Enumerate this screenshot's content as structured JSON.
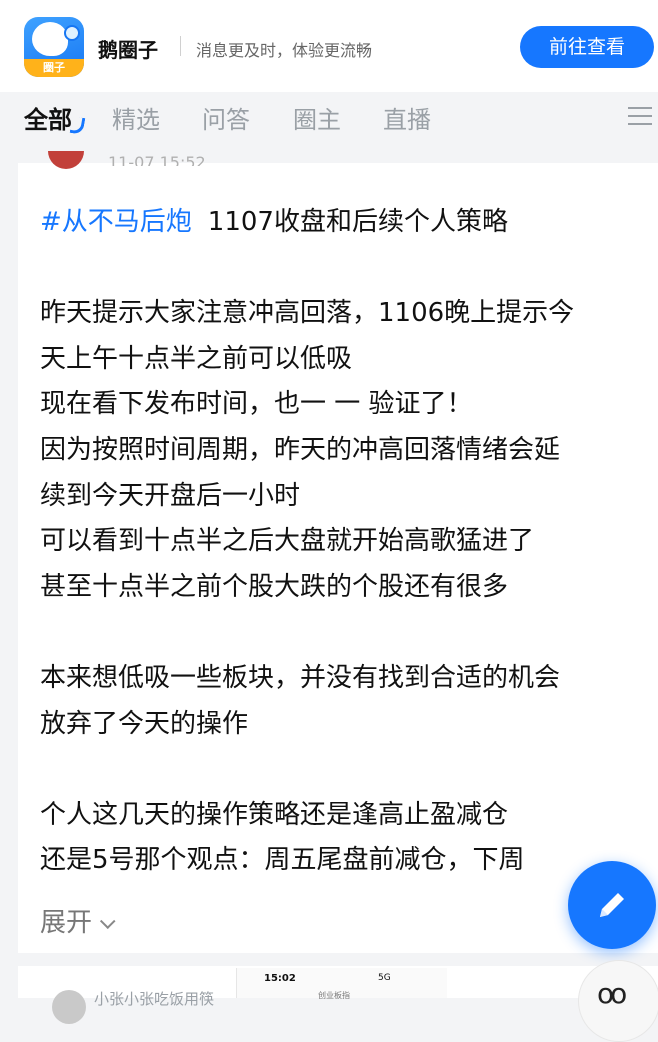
{
  "banner": {
    "logo_tag": "圈子",
    "app_name": "鹅圈子",
    "slogan": "消息更及时，体验更流畅",
    "open_button": "前往查看"
  },
  "tabs": [
    {
      "label": "全部",
      "active": true
    },
    {
      "label": "精选",
      "active": false
    },
    {
      "label": "问答",
      "active": false
    },
    {
      "label": "圈主",
      "active": false
    },
    {
      "label": "直播",
      "active": false
    }
  ],
  "post": {
    "timestamp": "11-07 15:52",
    "hashtag": "#从不马后炮",
    "title": "1107收盘和后续个人策略",
    "lines": [
      "昨天提示大家注意冲高回落，1106晚上提示今",
      "天上午十点半之前可以低吸",
      "现在看下发布时间，也一 一 验证了！",
      "因为按照时间周期，昨天的冲高回落情绪会延",
      "续到今天开盘后一小时",
      "可以看到十点半之后大盘就开始高歌猛进了",
      "甚至十点半之前个股大跌的个股还有很多",
      "本来想低吸一些板块，并没有找到合适的机会",
      "放弃了今天的操作",
      "个人这几天的操作策略还是逢高止盈减仓",
      "还是5号那个观点：周五尾盘前减仓，下周"
    ],
    "expand_label": "展开"
  },
  "next_post": {
    "username": "小张小张吃饭用筷",
    "thumb_time": "15:02",
    "thumb_status": "5G",
    "thumb_app": "创业板指"
  },
  "comment_icon": "oo",
  "colors": {
    "accent": "#1677ff",
    "background": "#f3f4f6",
    "card": "#ffffff"
  }
}
